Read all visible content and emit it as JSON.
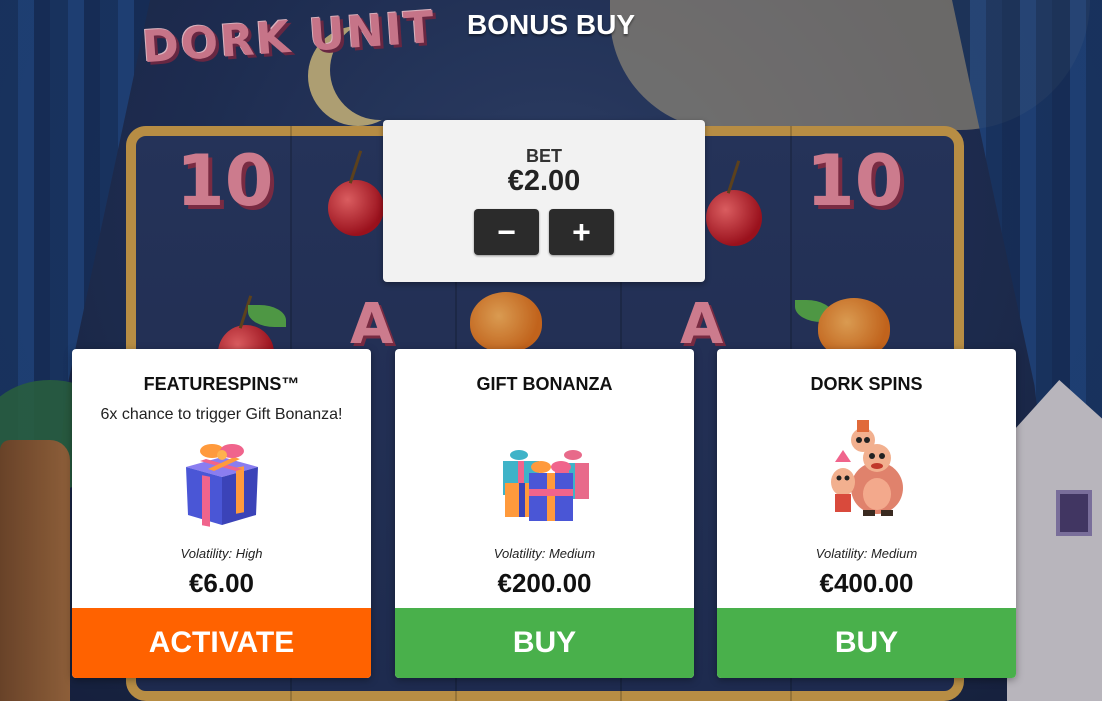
{
  "game": {
    "logo_text": "DORK UNIT"
  },
  "modal": {
    "title": "BONUS BUY"
  },
  "bet": {
    "label": "BET",
    "value": "€2.00",
    "decrease_symbol": "−",
    "increase_symbol": "+"
  },
  "background": {
    "reel_symbols": {
      "ten": "10",
      "letter_a": "A"
    }
  },
  "cards": [
    {
      "title": "FEATURESPINS™",
      "description": "6x chance to trigger Gift Bonanza!",
      "icon": "gift-box-icon",
      "volatility": "Volatility: High",
      "price": "€6.00",
      "button_label": "ACTIVATE",
      "button_color": "#ff6200"
    },
    {
      "title": "GIFT BONANZA",
      "icon": "gift-pile-icon",
      "volatility": "Volatility: Medium",
      "price": "€200.00",
      "button_label": "BUY",
      "button_color": "#49b04b"
    },
    {
      "title": "DORK SPINS",
      "icon": "dork-characters-icon",
      "volatility": "Volatility: Medium",
      "price": "€400.00",
      "button_label": "BUY",
      "button_color": "#49b04b"
    }
  ],
  "colors": {
    "activate": "#ff6200",
    "buy": "#49b04b",
    "panel": "#f2f2f2",
    "stepper": "#2b2b2b"
  }
}
